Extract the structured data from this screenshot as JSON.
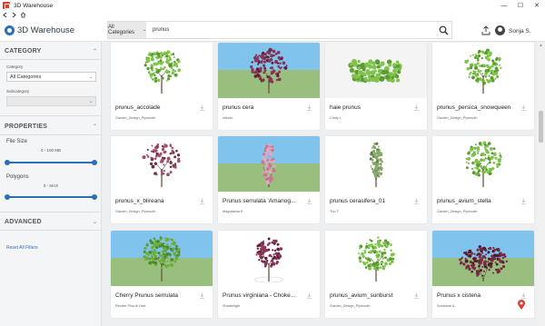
{
  "window": {
    "title": "3D Warehouse",
    "controls": [
      "—",
      "☐",
      "✕"
    ]
  },
  "nav": {
    "icons": [
      "left-arrow-icon",
      "right-arrow-icon",
      "home-icon"
    ]
  },
  "header": {
    "brand": "3D Warehouse",
    "category_label": "All Categories",
    "search_value": "prunus",
    "user_name": "Sonja S."
  },
  "sidebar": {
    "category_title": "CATEGORY",
    "category_label": "Category",
    "category_value": "All Categories",
    "subcategory_label": "Subcategory",
    "subcategory_value": "",
    "properties_title": "PROPERTIES",
    "file_size_label": "File Size",
    "file_size_range": "0 - 100 MB",
    "file_size_fraction": 1.0,
    "polygons_label": "Polygons",
    "polygons_range": "0 - MAX",
    "polygons_fraction": 1.0,
    "advanced_title": "ADVANCED",
    "reset_label": "Reset All Filters"
  },
  "results": [
    {
      "title": "prunus_accolade",
      "author": "Garden_Design_Plymouth",
      "thumb": "tree-green"
    },
    {
      "title": "prunus cera",
      "author": "mikoto",
      "thumb": "tree-purple"
    },
    {
      "title": "haie prunus",
      "author": "Cindy L.",
      "thumb": "hedge"
    },
    {
      "title": "prunus_persica_snowqueen",
      "author": "Garden_Design_Plymouth",
      "thumb": "tree-green"
    },
    {
      "title": "prunus_x_blireana",
      "author": "Garden_Design_Plymouth",
      "thumb": "tree-pink-sparse"
    },
    {
      "title": "Prunus serrulata 'Amanog...",
      "author": "Magdalena K.",
      "thumb": "tree-pink-column"
    },
    {
      "title": "prunus cerasifera_01",
      "author": "Thu T.",
      "thumb": "tree-column"
    },
    {
      "title": "prunus_avium_stella",
      "author": "Garden_Design_Plymouth",
      "thumb": "tree-green"
    },
    {
      "title": "Cherry Prunus serrulata",
      "author": "Render Plus Al Hart",
      "thumb": "tree-green-dense"
    },
    {
      "title": "Prunus virginiana - Choke...",
      "author": "Shaderlight",
      "thumb": "tree-purple-small"
    },
    {
      "title": "prunus_avium_sunburst",
      "author": "Garden_Design_Plymouth",
      "thumb": "tree-green"
    },
    {
      "title": "Prunus x cistena",
      "author": "Sunstone A.",
      "thumb": "shrub-purple"
    }
  ],
  "colors": {
    "accent": "#2a6fb8",
    "sky": "#80c3ec",
    "grass": "#98bf7e",
    "foliage_green": "#7ec34a",
    "foliage_purple": "#8a3356",
    "pin": "#d9402f"
  }
}
